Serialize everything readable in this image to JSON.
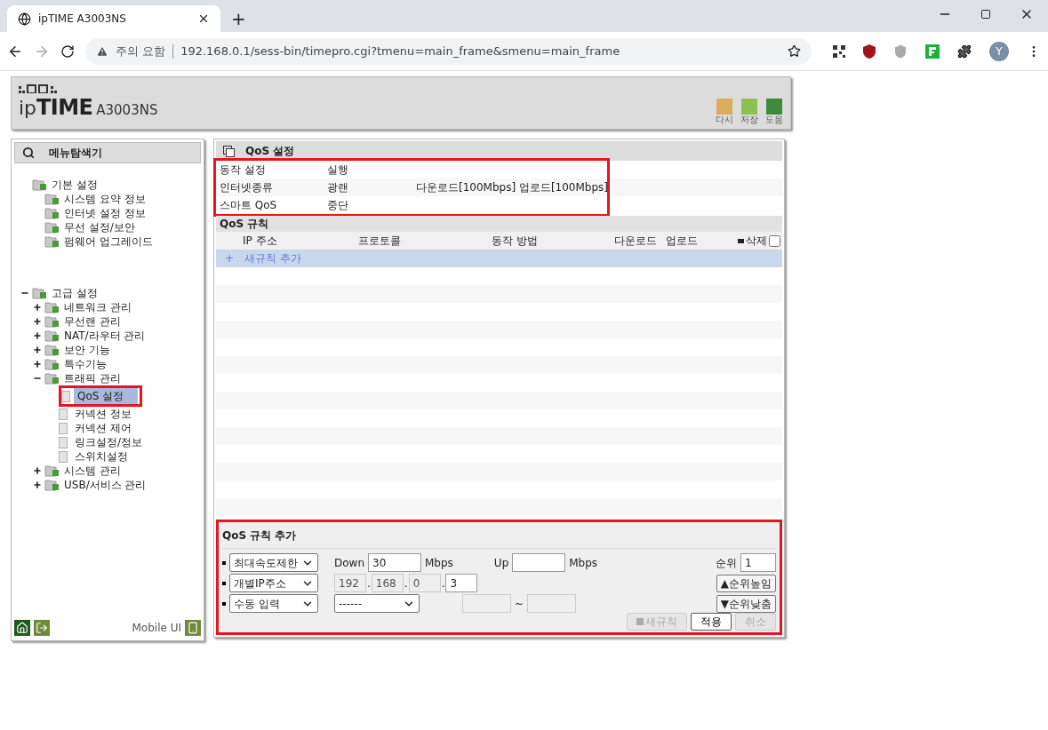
{
  "browser": {
    "tab_title": "ipTIME A3003NS",
    "new_tab": "+",
    "security_label": "주의 요함",
    "url": "192.168.0.1/sess-bin/timepro.cgi?tmenu=main_frame&smenu=main_frame",
    "profile_initial": "Y"
  },
  "header": {
    "logo_prefix": "ip",
    "logo_main": "TIME",
    "model": "A3003NS",
    "actions": [
      {
        "label": "다시",
        "color": "#d9ad5b"
      },
      {
        "label": "저장",
        "color": "#8cc152"
      },
      {
        "label": "도움",
        "color": "#3d8b3d"
      }
    ]
  },
  "sidebar": {
    "title": "메뉴탐색기",
    "tree": [
      {
        "label": "기본 설정",
        "children": [
          {
            "label": "시스템 요약 정보"
          },
          {
            "label": "인터넷 설정 정보"
          },
          {
            "label": "무선 설정/보안"
          },
          {
            "label": "펌웨어 업그레이드"
          }
        ]
      },
      {
        "label": "고급 설정",
        "expanded": true,
        "children": [
          {
            "label": "네트워크 관리",
            "expanded": false
          },
          {
            "label": "무선랜 관리",
            "expanded": false
          },
          {
            "label": "NAT/라우터 관리",
            "expanded": false
          },
          {
            "label": "보안 기능",
            "expanded": false
          },
          {
            "label": "특수기능",
            "expanded": false
          },
          {
            "label": "트래픽 관리",
            "expanded": true,
            "children": [
              {
                "label": "QoS 설정",
                "selected": true,
                "highlighted": true
              },
              {
                "label": "커넥션 정보",
                "selected": false,
                "highlighted": false
              },
              {
                "label": "커넥션 제어",
                "selected": false,
                "highlighted": false
              },
              {
                "label": "링크설정/정보",
                "selected": false,
                "highlighted": false
              },
              {
                "label": "스위치설정",
                "selected": false,
                "highlighted": false
              }
            ]
          },
          {
            "label": "시스템 관리",
            "expanded": false
          },
          {
            "label": "USB/서비스 관리",
            "expanded": false
          }
        ]
      }
    ],
    "footer_label": "Mobile UI"
  },
  "main": {
    "title": "QoS 설정",
    "status_highlighted": true,
    "status": [
      {
        "label": "동작 설정",
        "value": "실행"
      },
      {
        "label": "인터넷종류",
        "value": "광랜",
        "detail": "다운로드[100Mbps] 업로드[100Mbps]"
      },
      {
        "label": "스마트 QoS",
        "value": "중단"
      }
    ],
    "rules_title": "QoS 규칙",
    "columns": [
      "IP 주소",
      "프로토콜",
      "동작 방법",
      "다운로드",
      "업로드"
    ],
    "delete_label": "삭제",
    "delete_all_checked": false,
    "new_rule": {
      "icon": "+",
      "label": "새규칙 추가"
    }
  },
  "add_form": {
    "title": "QoS 규칙 추가",
    "highlighted": true,
    "mode_select": "최대속도제한",
    "down_label": "Down",
    "down_value": "30",
    "unit": "Mbps",
    "up_label": "Up",
    "unit2": "Mbps",
    "priority_label": "순위",
    "priority_value": "1",
    "target_select": "개별IP주소",
    "ip": [
      {
        "value": "192",
        "disabled": true
      },
      {
        "value": "168",
        "disabled": true
      },
      {
        "value": "0",
        "disabled": true
      },
      {
        "value": "3",
        "disabled": false
      }
    ],
    "ip_sep": ".",
    "raise_button": "▲순위높임",
    "protocol_select": "수동 입력",
    "port_select": "------",
    "range_sep": "~",
    "lower_button": "▼순위낮춤",
    "buttons": [
      {
        "label": "새규칙",
        "disabled": true,
        "kind": "new"
      },
      {
        "label": "적용",
        "disabled": false,
        "kind": "plain"
      },
      {
        "label": "취소",
        "disabled": true,
        "kind": "plain"
      }
    ]
  }
}
